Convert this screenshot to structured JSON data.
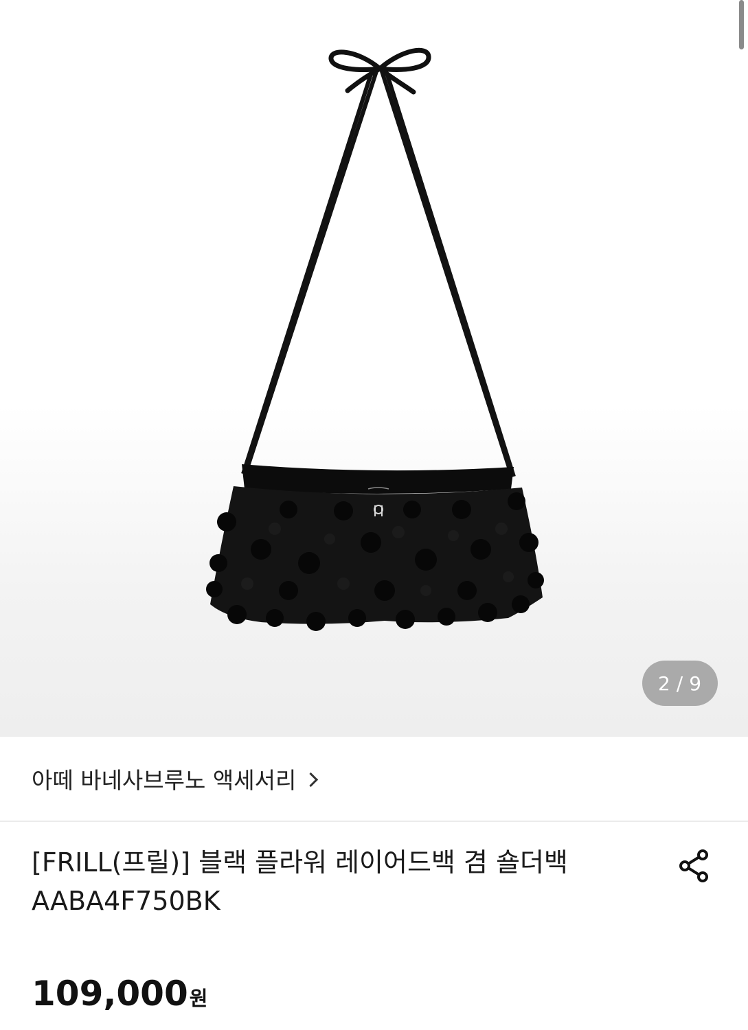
{
  "gallery": {
    "current": "2",
    "separator": "/",
    "total": "9"
  },
  "brand": {
    "label": "아떼 바네사브루노 액세서리"
  },
  "product": {
    "title_line1": "[FRILL(프릴)] 블랙 플라워 레이어드백 겸 숄더백",
    "title_line2": "AABA4F750BK",
    "price": "109,000",
    "currency": "원"
  },
  "icons": {
    "brand_chevron": "chevron-right-icon",
    "share": "share-icon"
  }
}
